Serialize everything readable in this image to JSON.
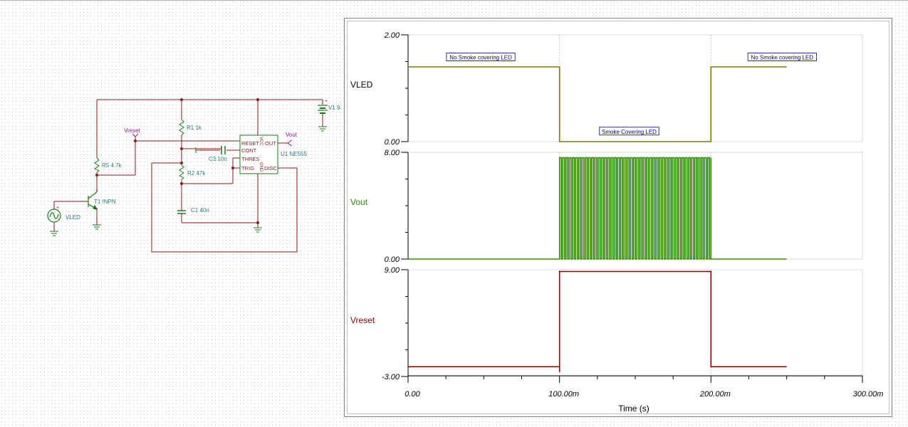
{
  "schematic": {
    "labels": {
      "vreset_node": "Vreset",
      "vout_node": "Vout",
      "v1": "V1 9",
      "r1": "R1 1k",
      "r2": "R2 47k",
      "r5": "R5 4.7k",
      "c1": "C1 40n",
      "c3": "C3 10n",
      "u1": "U1 NE555",
      "t1": "T1 !NPN",
      "vled": "VLED",
      "pin_reset": "RESET",
      "pin_cont": "CONT",
      "pin_thres": "THRES",
      "pin_trig": "TRIG",
      "pin_out": "OUT",
      "pin_disc": "DISC",
      "pin_vcc": "VCC",
      "pin_gnd": "GND"
    },
    "colors": {
      "wire": "#8b1a1a",
      "component": "#1a7a1a",
      "label": "#2a7a7a",
      "node_label": "#8b1a8b"
    }
  },
  "chart_data": {
    "type": "line",
    "xlabel": "Time (s)",
    "x_ticks": [
      "0.00",
      "100.00m",
      "200.00m",
      "300.00m"
    ],
    "xlim": [
      0,
      0.3
    ],
    "panels": [
      {
        "name": "VLED",
        "color": "#7a7a00",
        "ylim": [
          0,
          2
        ],
        "y_ticks": [
          "2.00",
          "0.00"
        ],
        "points": [
          [
            0,
            1.4
          ],
          [
            0.1,
            1.4
          ],
          [
            0.1,
            0
          ],
          [
            0.2,
            0
          ],
          [
            0.2,
            1.4
          ],
          [
            0.25,
            1.4
          ]
        ],
        "annotations": [
          {
            "text": "No Smoke covering LED",
            "x": 0.048,
            "y": 1.58
          },
          {
            "text": "Smoke Covering LED",
            "x": 0.146,
            "y": 0.19
          },
          {
            "text": "No Smoke covering LED",
            "x": 0.247,
            "y": 1.58
          }
        ]
      },
      {
        "name": "Vout",
        "color": "#2e8b00",
        "ylim": [
          0,
          8
        ],
        "y_ticks": [
          "8.00",
          "0.00"
        ],
        "pulse_train": {
          "start": 0.1,
          "end": 0.2,
          "high": 7.6,
          "low": 0,
          "cycles": 47
        },
        "points": [
          [
            0,
            0
          ],
          [
            0.1,
            0
          ],
          [
            0.2,
            0
          ],
          [
            0.25,
            0
          ]
        ]
      },
      {
        "name": "Vreset",
        "color": "#8b0000",
        "ylim": [
          -3,
          9
        ],
        "y_ticks": [
          "9.00",
          "-3.00"
        ],
        "points": [
          [
            0,
            -1.9
          ],
          [
            0.1,
            -1.9
          ],
          [
            0.1,
            -2.5
          ],
          [
            0.1,
            8.8
          ],
          [
            0.2,
            8.8
          ],
          [
            0.2,
            -1.9
          ],
          [
            0.25,
            -1.9
          ]
        ]
      }
    ]
  }
}
